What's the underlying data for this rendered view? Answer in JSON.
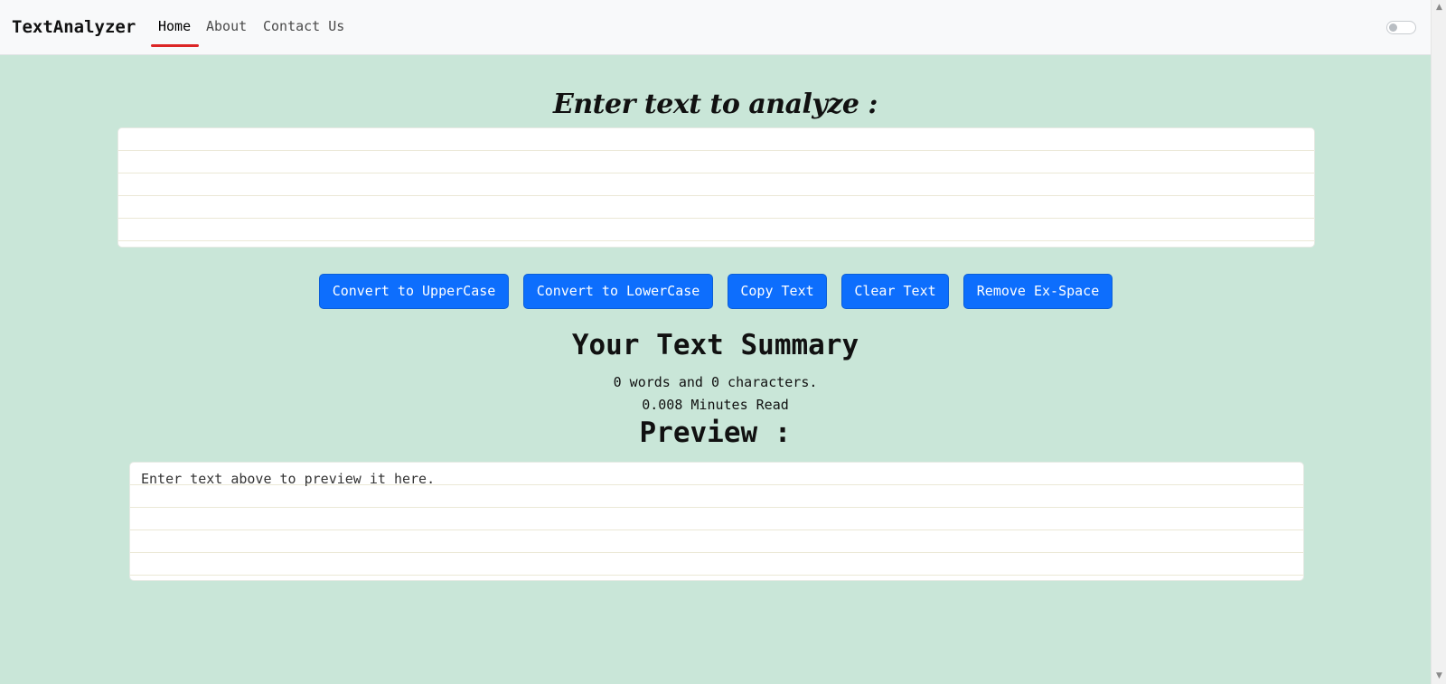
{
  "navbar": {
    "brand": "TextAnalyzer",
    "links": [
      "Home",
      "About",
      "Contact Us"
    ],
    "active_link": "Home"
  },
  "main": {
    "heading": "Enter text to analyze :",
    "textarea_value": "",
    "buttons": [
      "Convert to UpperCase",
      "Convert to LowerCase",
      "Copy Text",
      "Clear Text",
      "Remove Ex-Space"
    ],
    "summary_title": "Your Text Summary",
    "counts_line": "0 words and 0 characters.",
    "read_time_line": "0.008 Minutes Read",
    "preview_title": "Preview :",
    "preview_text": "Enter text above to preview it here."
  },
  "colors": {
    "page_background": "#c9e6d8",
    "navbar_background": "#f8f9fa",
    "button_primary": "#0d6efd",
    "active_underline": "#dc2626"
  },
  "icons": {
    "toggle": "toggle-switch-icon",
    "scroll_up": "chevron-up-icon",
    "scroll_down": "chevron-down-icon"
  }
}
